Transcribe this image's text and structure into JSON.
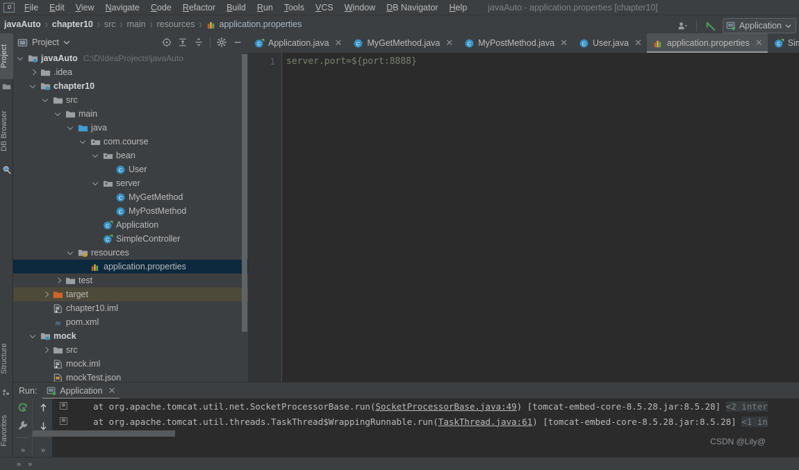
{
  "window": {
    "title": "javaAuto - application.properties [chapter10]"
  },
  "menubar": {
    "items": [
      {
        "label": "File",
        "mnemonic": "F"
      },
      {
        "label": "Edit",
        "mnemonic": "E"
      },
      {
        "label": "View",
        "mnemonic": "V"
      },
      {
        "label": "Navigate",
        "mnemonic": "N"
      },
      {
        "label": "Code",
        "mnemonic": "C"
      },
      {
        "label": "Refactor",
        "mnemonic": "R"
      },
      {
        "label": "Build",
        "mnemonic": "B"
      },
      {
        "label": "Run",
        "mnemonic": "R"
      },
      {
        "label": "Tools",
        "mnemonic": "T"
      },
      {
        "label": "VCS",
        "mnemonic": "V"
      },
      {
        "label": "Window",
        "mnemonic": "W"
      },
      {
        "label": "DB Navigator",
        "mnemonic": "D"
      },
      {
        "label": "Help",
        "mnemonic": "H"
      }
    ]
  },
  "breadcrumb": {
    "items": [
      {
        "label": "javaAuto",
        "style": "bold"
      },
      {
        "label": "chapter10",
        "style": "bold"
      },
      {
        "label": "src",
        "style": "dim"
      },
      {
        "label": "main",
        "style": "dim"
      },
      {
        "label": "resources",
        "style": "dim"
      },
      {
        "label": "application.properties",
        "style": "file",
        "icon": "properties-file-icon"
      }
    ]
  },
  "toolbar": {
    "user_icon": "user-dropdown-icon",
    "update_icon": "update-project-icon",
    "run_config": {
      "label": "Application",
      "icon": "run-configuration-icon",
      "chevron": "chevron-down-icon"
    }
  },
  "left_tool_strip": {
    "tabs": [
      {
        "label": "Project",
        "active": true,
        "icon": "project-icon"
      },
      {
        "label": "DB Browser",
        "active": false,
        "icon": "db-browser-icon"
      },
      {
        "label": "Structure",
        "active": false,
        "icon": "structure-icon"
      },
      {
        "label": "Favorites",
        "active": false,
        "icon": "favorites-star-icon"
      }
    ]
  },
  "project_panel": {
    "title": "Project",
    "title_chevron": "chevron-down-icon",
    "header_icons": [
      {
        "name": "scroll-from-source-icon"
      },
      {
        "name": "expand-all-icon"
      },
      {
        "name": "collapse-all-icon"
      },
      {
        "name": "settings-gear-icon"
      },
      {
        "name": "hide-panel-icon"
      }
    ],
    "tree": [
      {
        "label": "javaAuto",
        "path": "C:\\D\\IdeaProjects\\javaAuto",
        "depth": 0,
        "arrow": "down",
        "icon": "module-folder-icon",
        "bold": true
      },
      {
        "label": ".idea",
        "depth": 1,
        "arrow": "right",
        "icon": "folder-icon"
      },
      {
        "label": "chapter10",
        "depth": 1,
        "arrow": "down",
        "icon": "module-folder-icon",
        "bold": true
      },
      {
        "label": "src",
        "depth": 2,
        "arrow": "down",
        "icon": "folder-icon"
      },
      {
        "label": "main",
        "depth": 3,
        "arrow": "down",
        "icon": "folder-icon"
      },
      {
        "label": "java",
        "depth": 4,
        "arrow": "down",
        "icon": "source-root-folder-icon"
      },
      {
        "label": "com.course",
        "depth": 5,
        "arrow": "down",
        "icon": "package-icon"
      },
      {
        "label": "bean",
        "depth": 6,
        "arrow": "down",
        "icon": "package-icon"
      },
      {
        "label": "User",
        "depth": 7,
        "arrow": "none",
        "icon": "java-class-icon"
      },
      {
        "label": "server",
        "depth": 6,
        "arrow": "down",
        "icon": "package-icon"
      },
      {
        "label": "MyGetMethod",
        "depth": 7,
        "arrow": "none",
        "icon": "java-class-icon"
      },
      {
        "label": "MyPostMethod",
        "depth": 7,
        "arrow": "none",
        "icon": "java-class-icon"
      },
      {
        "label": "Application",
        "depth": 6,
        "arrow": "none",
        "icon": "runnable-java-class-icon"
      },
      {
        "label": "SimpleController",
        "depth": 6,
        "arrow": "none",
        "icon": "runnable-java-class-icon"
      },
      {
        "label": "resources",
        "depth": 4,
        "arrow": "down",
        "icon": "resources-root-folder-icon"
      },
      {
        "label": "application.properties",
        "depth": 5,
        "arrow": "none",
        "icon": "properties-file-icon",
        "selected": true
      },
      {
        "label": "test",
        "depth": 3,
        "arrow": "right",
        "icon": "folder-icon"
      },
      {
        "label": "target",
        "depth": 2,
        "arrow": "right",
        "icon": "excluded-folder-icon",
        "highlight": "target"
      },
      {
        "label": "chapter10.iml",
        "depth": 2,
        "arrow": "none",
        "icon": "iml-file-icon"
      },
      {
        "label": "pom.xml",
        "depth": 2,
        "arrow": "none",
        "icon": "maven-pom-icon"
      },
      {
        "label": "mock",
        "depth": 1,
        "arrow": "down",
        "icon": "module-folder-icon",
        "bold": true
      },
      {
        "label": "src",
        "depth": 2,
        "arrow": "right",
        "icon": "folder-icon"
      },
      {
        "label": "mock.iml",
        "depth": 2,
        "arrow": "none",
        "icon": "iml-file-icon"
      },
      {
        "label": "mockTest.json",
        "depth": 2,
        "arrow": "none",
        "icon": "json-file-icon"
      }
    ]
  },
  "editor": {
    "tabs": [
      {
        "label": "Application.java",
        "icon": "runnable-java-class-icon",
        "active": false,
        "closable": true
      },
      {
        "label": "MyGetMethod.java",
        "icon": "java-class-icon",
        "active": false,
        "closable": true
      },
      {
        "label": "MyPostMethod.java",
        "icon": "java-class-icon",
        "active": false,
        "closable": true
      },
      {
        "label": "User.java",
        "icon": "java-class-icon",
        "active": false,
        "closable": true
      },
      {
        "label": "application.properties",
        "icon": "properties-file-icon",
        "active": true,
        "closable": true
      },
      {
        "label": "Sim",
        "icon": "runnable-java-class-icon",
        "active": false,
        "closable": false
      }
    ],
    "line_number": "1",
    "code": "server.port=${port:8888}"
  },
  "run_panel": {
    "label": "Run:",
    "tab": {
      "label": "Application",
      "icon": "run-configuration-icon",
      "close": "close-icon"
    },
    "side_buttons": [
      {
        "name": "rerun-icon"
      },
      {
        "name": "wrench-settings-icon"
      },
      {
        "name": "up-arrow-icon"
      },
      {
        "name": "down-arrow-icon"
      },
      {
        "name": "expand-more-left-icon",
        "label": "»"
      },
      {
        "name": "expand-more-right-icon",
        "label": "»"
      }
    ],
    "console_lines": [
      {
        "fold": "⊞",
        "pre": "    at org.apache.tomcat.util.net.SocketProcessorBase.run(",
        "link": "SocketProcessorBase.java:49",
        "mid": ") [tomcat-embed-core-8.5.28.jar:8.5.28] ",
        "dim": "<2 inter"
      },
      {
        "fold": "⊞",
        "pre": "    at org.apache.tomcat.util.threads.TaskThread$WrappingRunnable.run(",
        "link": "TaskThread.java:61",
        "mid": ") [tomcat-embed-core-8.5.28.jar:8.5.28] ",
        "dim": "<1 in"
      }
    ]
  },
  "watermark": "CSDN @Lily@",
  "status_bar": {
    "left_arrows": [
      "»",
      "»"
    ]
  },
  "colors": {
    "panel_bg": "#3c3f41",
    "editor_bg": "#2b2b2b",
    "selection_blue": "#0d293e",
    "target_highlight": "#4e4a39",
    "text": "#bbbbbb",
    "accent_blue": "#3592c4",
    "accent_green": "#499c54",
    "accent_orange": "#cc7832"
  }
}
